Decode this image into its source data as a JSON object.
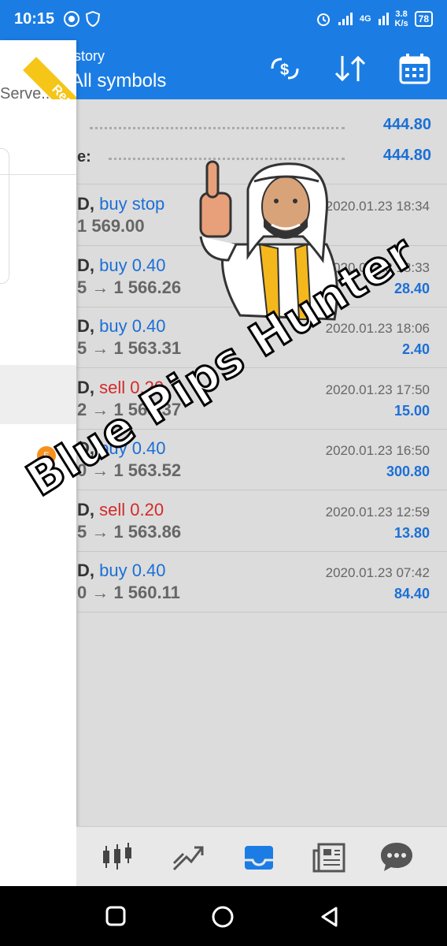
{
  "status_bar": {
    "time": "10:15",
    "network": "4G",
    "speed": "3.8",
    "speed_unit": "K/s",
    "battery": "78"
  },
  "header": {
    "title": "History",
    "subtitle": "All symbols",
    "title_visible": "istory",
    "subtitle_visible": "All symbols"
  },
  "drawer": {
    "server_text": "Serve...",
    "badge_count": "5",
    "ribbon": "Real"
  },
  "summary": [
    {
      "label": "",
      "value": "444.80"
    },
    {
      "label": "e:",
      "value": "444.80"
    }
  ],
  "trades": [
    {
      "sym": "D,",
      "action": "buy stop",
      "type": "buy",
      "line2": "1 569.00",
      "date": "2020.01.23 18:34",
      "profit": ""
    },
    {
      "sym": "D,",
      "action": "buy 0.40",
      "type": "buy",
      "line2": "5 → 1 566.26",
      "date": "020.01.23 18:33",
      "profit": "28.40"
    },
    {
      "sym": "D,",
      "action": "buy 0.40",
      "type": "buy",
      "line2": "5 → 1 563.31",
      "date": "2020.01.23 18:06",
      "profit": "2.40"
    },
    {
      "sym": "D,",
      "action": "sell 0.20",
      "type": "sell",
      "line2": "2 → 1 563.37",
      "date": "2020.01.23 17:50",
      "profit": "15.00"
    },
    {
      "sym": "D,",
      "action": "buy 0.40",
      "type": "buy",
      "line2": "0 → 1 563.52",
      "date": "2020.01.23 16:50",
      "profit": "300.80"
    },
    {
      "sym": "D,",
      "action": "sell 0.20",
      "type": "sell",
      "line2": "5 → 1 563.86",
      "date": "2020.01.23 12:59",
      "profit": "13.80"
    },
    {
      "sym": "D,",
      "action": "buy 0.40",
      "type": "buy",
      "line2": "0 → 1 560.11",
      "date": "2020.01.23 07:42",
      "profit": "84.40"
    }
  ],
  "toolbar": {
    "items": [
      "quotes-icon",
      "trade-chart-icon",
      "history-inbox-icon",
      "news-icon",
      "chat-icon"
    ],
    "active": "history-inbox-icon"
  },
  "watermark": "Blue Pips Hunter",
  "colors": {
    "accent": "#1b7de4",
    "buy": "#1b6fd6",
    "sell": "#d22a2a",
    "badge": "#f5901e"
  }
}
